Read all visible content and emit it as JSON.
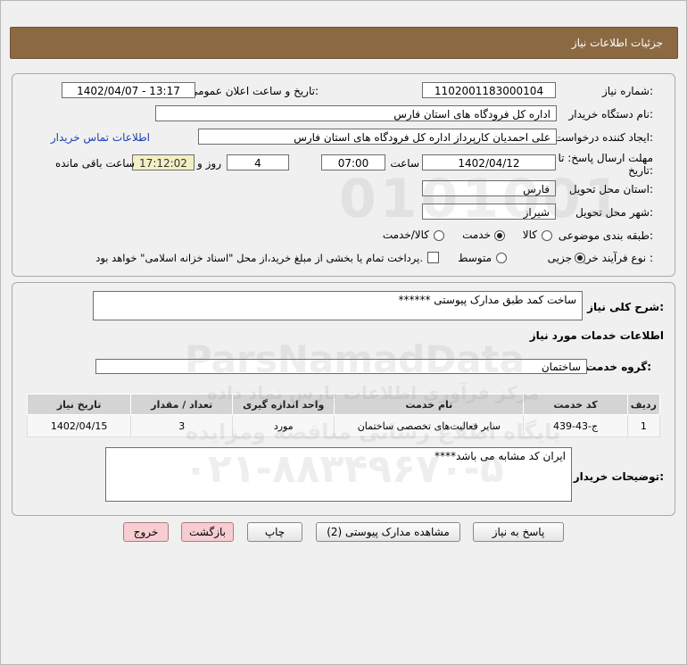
{
  "header": {
    "title": "جزئیات اطلاعات نیاز"
  },
  "form": {
    "need_number_label": "شماره نیاز:",
    "need_number": "1102001183000104",
    "announce_label": "تاریخ و ساعت اعلان عمومی:",
    "announce_value": "1402/04/07 - 13:17",
    "buyer_org_label": "نام دستگاه خریدار:",
    "buyer_org": "اداره کل فرودگاه های استان فارس",
    "requester_label": "ایجاد کننده درخواست:",
    "requester": "علی  احمدیان کارپرداز اداره کل فرودگاه های استان فارس",
    "contact_link": "اطلاعات تماس خریدار",
    "deadline_label_1": "مهلت ارسال پاسخ: تا",
    "deadline_label_2": "تاریخ:",
    "deadline_date": "1402/04/12",
    "hour_label": "ساعت",
    "deadline_time": "07:00",
    "days_value": "4",
    "days_label": "روز و",
    "remaining_time": "17:12:02",
    "remaining_label": "ساعت باقی مانده",
    "province_label": "استان محل تحویل:",
    "province": "فارس",
    "city_label": "شهر محل تحویل:",
    "city": "شیراز",
    "category_label": "طبقه بندی موضوعی:",
    "category_options": [
      "کالا",
      "خدمت",
      "کالا/خدمت"
    ],
    "category_selected": "خدمت",
    "process_label": "نوع فرآیند خرید :",
    "process_options": [
      "جزیی",
      "متوسط"
    ],
    "process_selected": "جزیی",
    "payment_note": "پرداخت تمام یا بخشی از مبلغ خرید،از محل \"اسناد خزانه اسلامی\" خواهد بود."
  },
  "details": {
    "summary_label": "شرح کلی نیاز:",
    "summary": "ساخت کمد طبق مدارک پیوستی ******",
    "services_heading": "اطلاعات خدمات مورد نیاز",
    "service_group_label": "گروه خدمت:",
    "service_group": "ساختمان",
    "table": {
      "headers": [
        "ردیف",
        "کد خدمت",
        "نام خدمت",
        "واحد اندازه گیری",
        "تعداد / مقدار",
        "تاریخ نیاز"
      ],
      "rows": [
        [
          "1",
          "ج-43-439",
          "سایر فعالیت‌های تخصصی ساختمان",
          "مورد",
          "3",
          "1402/04/15"
        ]
      ]
    },
    "buyer_notes_label": "توضیحات خریدار:",
    "buyer_notes": "ایران کد مشابه می باشد****"
  },
  "buttons": {
    "reply": "پاسخ به نیاز",
    "view_docs": "مشاهده مدارک پیوستی (2)",
    "print": "چاپ",
    "back": "بازگشت",
    "exit": "خروج"
  },
  "watermark": {
    "brand": "ParsNamadData",
    "subtitle": "مرکز فرآوری اطلاعات پارس نماد داده",
    "line": "پایگاه اطلاع رسانی مناقصه ومزایده",
    "phone": "۰۲۱-۸۸۳۴۹۶۷۰-۵",
    "digits": "0101001"
  }
}
